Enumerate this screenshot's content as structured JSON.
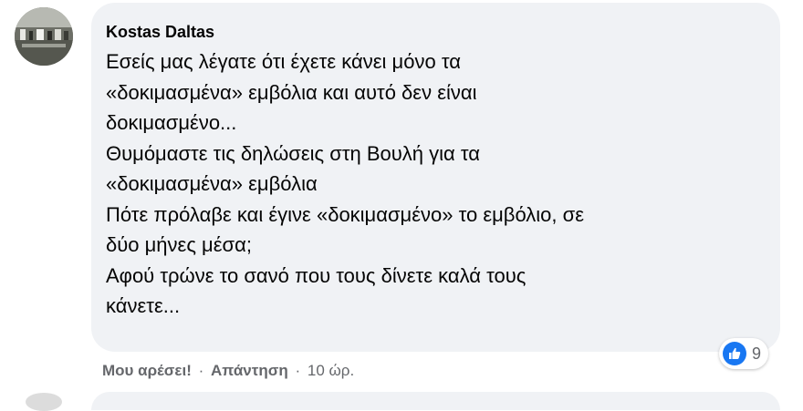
{
  "comment": {
    "author": "Kostas Daltas",
    "lines": [
      "Εσείς μας λέγατε ότι έχετε κάνει μόνο τα",
      "«δοκιμασμένα» εμβόλια και αυτό δεν είναι",
      "δοκιμασμένο...",
      "Θυμόμαστε τις δηλώσεις στη Βουλή για τα",
      "«δοκιμασμένα» εμβόλια",
      "Πότε πρόλαβε και έγινε «δοκιμασμένο» το εμβόλιο, σε",
      "δύο μήνες μέσα;",
      "Αφού τρώνε το σανό που τους δίνετε καλά τους",
      "κάνετε..."
    ],
    "reactions": {
      "icon": "like-icon",
      "count": "9",
      "color": "#1877f2"
    },
    "actions": {
      "like_label": "Μου αρέσει!",
      "separator": "·",
      "reply_label": "Απάντηση",
      "timestamp": "10 ώρ."
    }
  },
  "colors": {
    "bubble_bg": "#f0f2f5",
    "text": "#050505",
    "secondary_text": "#65676b"
  }
}
